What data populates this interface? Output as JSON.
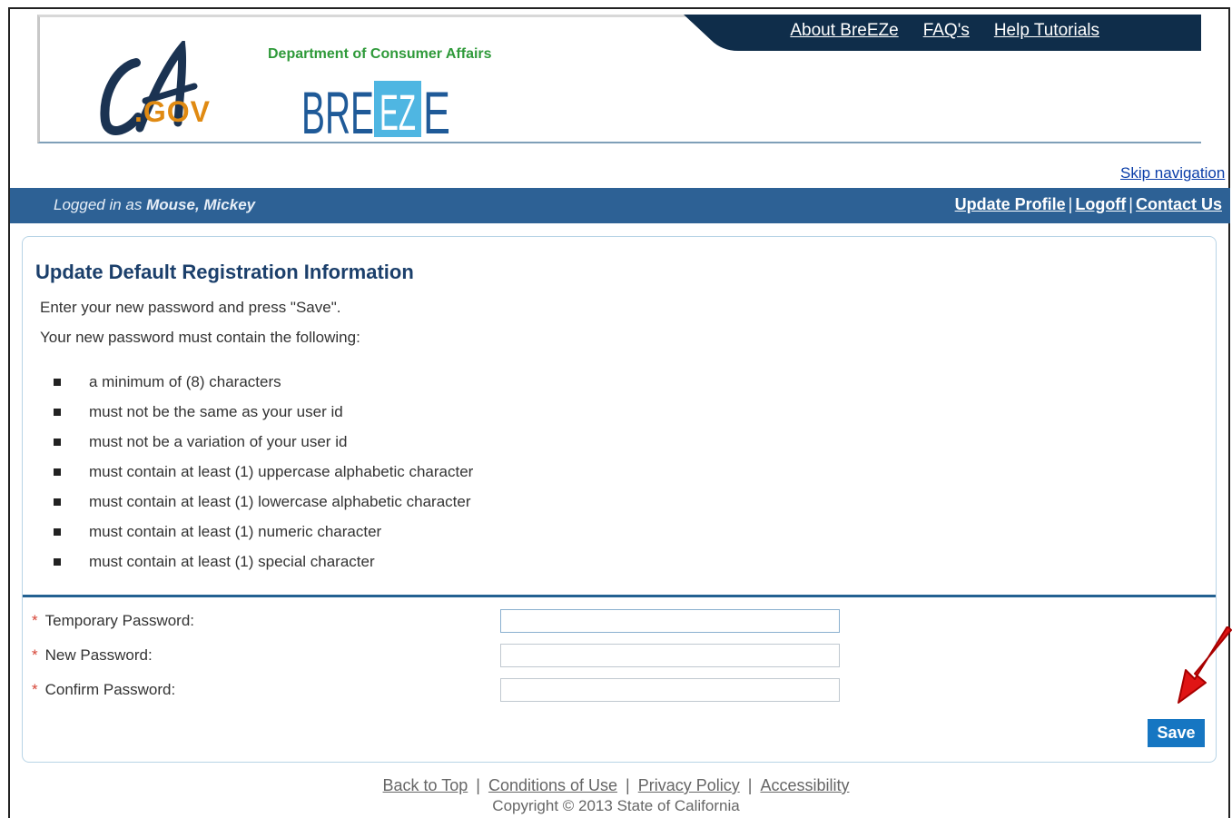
{
  "header": {
    "links": [
      "About BreEZe",
      "FAQ's",
      "Help Tutorials"
    ],
    "ca_gov": ".GOV",
    "department": "Department of Consumer Affairs",
    "brand": "BREEZE"
  },
  "skip_navigation": "Skip navigation",
  "session_bar": {
    "logged_prefix": "Logged in as",
    "user_name": "Mouse, Mickey",
    "links": [
      "Update Profile",
      "Logoff",
      "Contact Us"
    ],
    "separator": "|"
  },
  "form": {
    "title": "Update Default Registration Information",
    "intro_1": "Enter your new password and press \"Save\".",
    "intro_2": "Your new password must contain the following:",
    "rules": [
      "a minimum of (8) characters",
      "must not be the same as your user id",
      "must not be a variation of your user id",
      "must contain at least (1) uppercase alphabetic character",
      "must contain at least (1) lowercase alphabetic character",
      "must contain at least (1) numeric character",
      "must contain at least (1) special character"
    ],
    "required_mark": "*",
    "fields": [
      {
        "label": "Temporary Password:",
        "value": ""
      },
      {
        "label": "New Password:",
        "value": ""
      },
      {
        "label": "Confirm Password:",
        "value": ""
      }
    ],
    "save_label": "Save"
  },
  "footer": {
    "links": [
      "Back to Top",
      "Conditions of Use",
      "Privacy Policy",
      "Accessibility"
    ],
    "copyright": "Copyright © 2013 State of California"
  },
  "colors": {
    "header_navy": "#0f2d4a",
    "session_bar": "#2d6195",
    "title": "#1b3f6b",
    "save_button": "#1676c2",
    "arrow": "#e01515"
  }
}
